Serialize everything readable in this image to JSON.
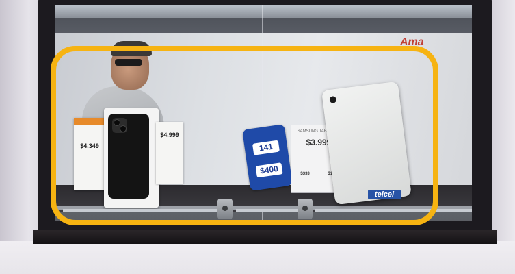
{
  "photo": {
    "brand_mark_text": "Ama",
    "price_cards": [
      {
        "price": "$4.349"
      },
      {
        "price": "$4.999"
      }
    ],
    "promo_tag": {
      "top_price": "141",
      "bottom_price": "$400"
    },
    "samsung_card": {
      "label": "SAMSUNG TABLET A9",
      "price": "$3.999",
      "sub_left": "$333",
      "sub_right": "$116"
    },
    "carrier_label": "telcel",
    "highlight_color": "#f6b312"
  }
}
